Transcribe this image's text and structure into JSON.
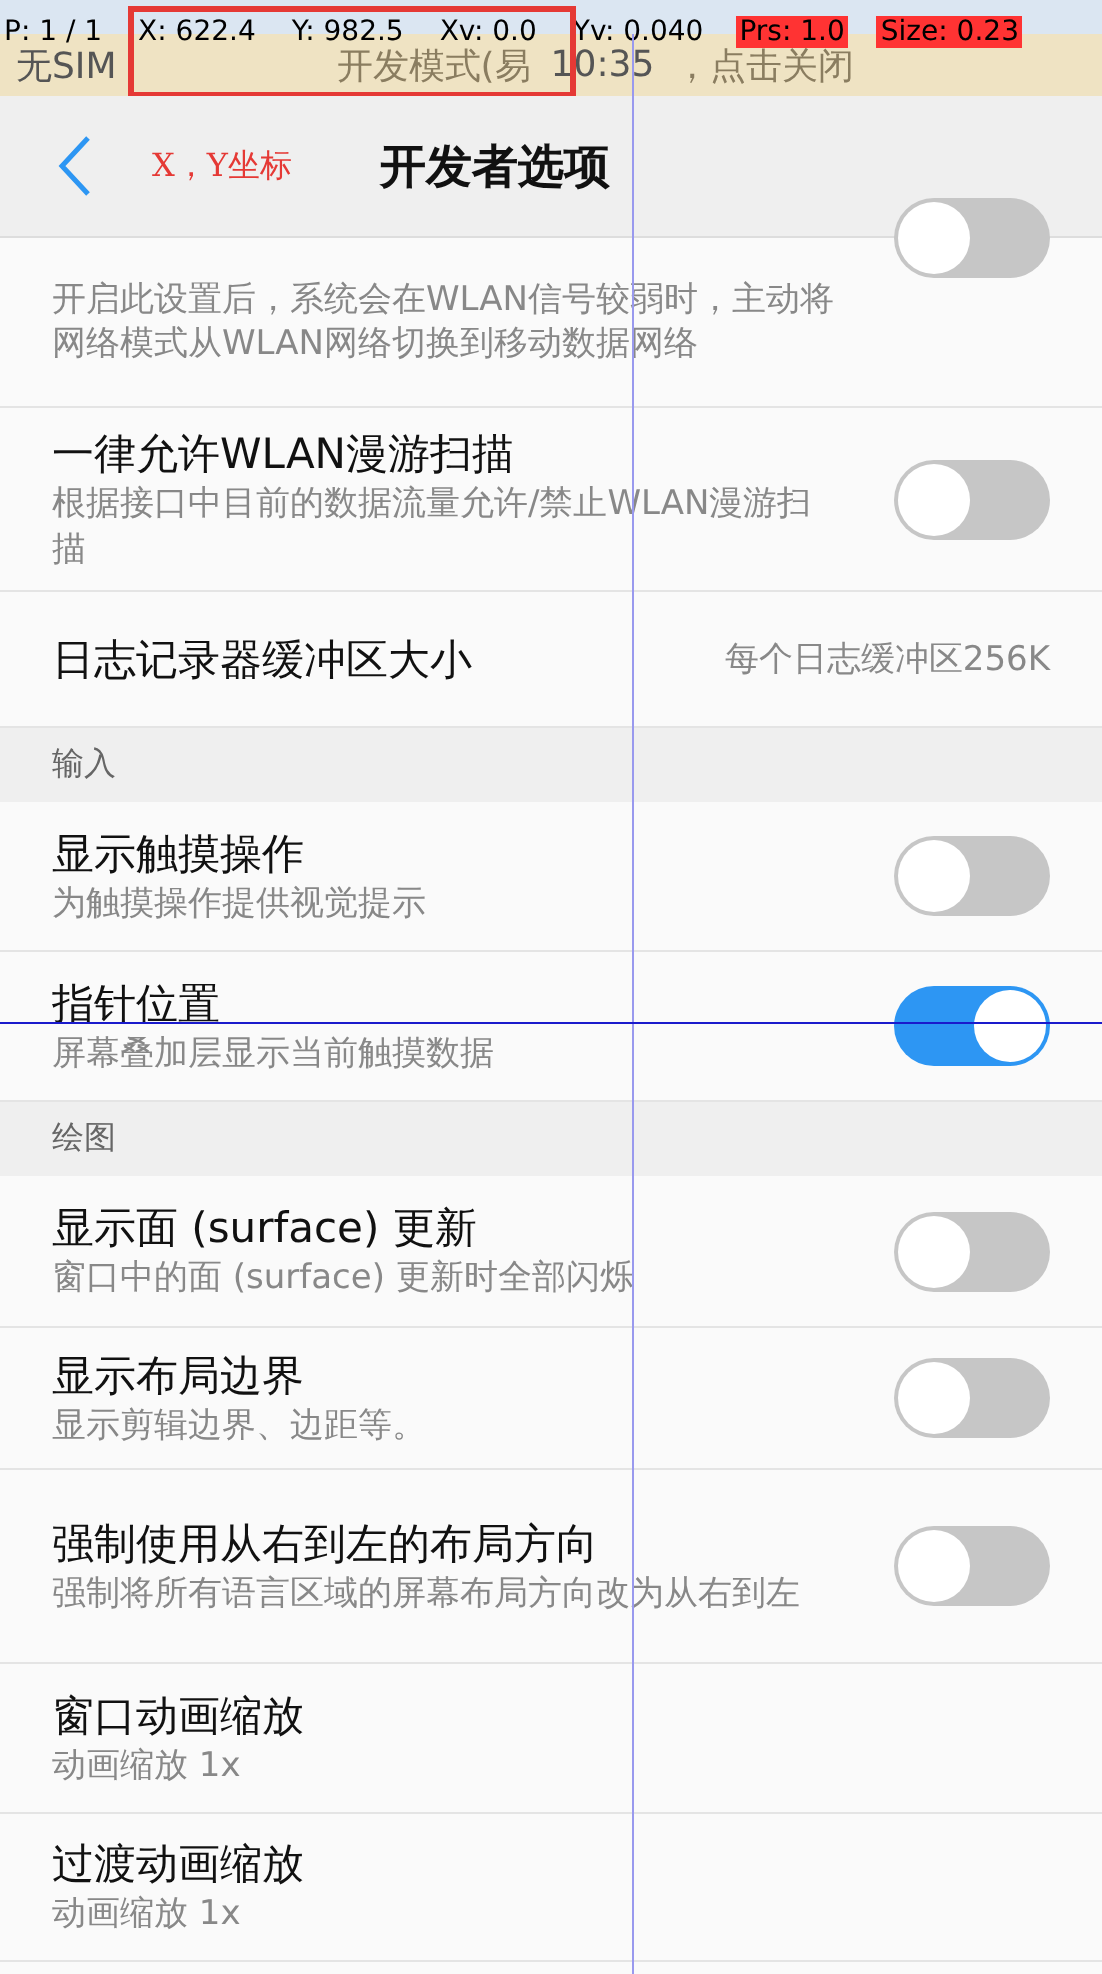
{
  "pointer_overlay": {
    "fields": [
      {
        "text": "P: 1 / 1",
        "highlighted": false
      },
      {
        "text": "X: 622.4",
        "highlighted": false
      },
      {
        "text": "Y: 982.5",
        "highlighted": false
      },
      {
        "text": "Xv: 0.0",
        "highlighted": false
      },
      {
        "text": "Yv: 0.040",
        "highlighted": false
      },
      {
        "text": "Prs: 1.0",
        "highlighted": true
      },
      {
        "text": "Size: 0.23",
        "highlighted": true
      }
    ]
  },
  "status_bar": {
    "carrier": "无SIM",
    "notification": "开发模式(易",
    "time": "10:35",
    "notification_end": "，点击关闭"
  },
  "header": {
    "annotation": "X，Y坐标",
    "title": "开发者选项"
  },
  "list": [
    {
      "kind": "toggle",
      "description": "开启此设置后，系统会在WLAN信号较弱时，主动将网络模式从WLAN网络切换到移动数据网络",
      "on": false
    },
    {
      "kind": "toggle",
      "title": "一律允许WLAN漫游扫描",
      "description": "根据接口中目前的数据流量允许/禁止WLAN漫游扫描",
      "on": false
    },
    {
      "kind": "value",
      "title": "日志记录器缓冲区大小",
      "value": "每个日志缓冲区256K"
    },
    {
      "kind": "section",
      "title": "输入"
    },
    {
      "kind": "toggle",
      "title": "显示触摸操作",
      "description": "为触摸操作提供视觉提示",
      "on": false
    },
    {
      "kind": "toggle",
      "title": "指针位置",
      "description": "屏幕叠加层显示当前触摸数据",
      "on": true
    },
    {
      "kind": "section",
      "title": "绘图"
    },
    {
      "kind": "toggle",
      "title": "显示面 (surface) 更新",
      "description": "窗口中的面 (surface) 更新时全部闪烁",
      "on": false
    },
    {
      "kind": "toggle",
      "title": "显示布局边界",
      "description": "显示剪辑边界、边距等。",
      "on": false
    },
    {
      "kind": "toggle",
      "title": "强制使用从右到左的布局方向",
      "description": "强制将所有语言区域的屏幕布局方向改为从右到左",
      "on": false
    },
    {
      "kind": "value",
      "title": "窗口动画缩放",
      "description": "动画缩放 1x"
    },
    {
      "kind": "value",
      "title": "过渡动画缩放",
      "description": "动画缩放 1x"
    }
  ]
}
